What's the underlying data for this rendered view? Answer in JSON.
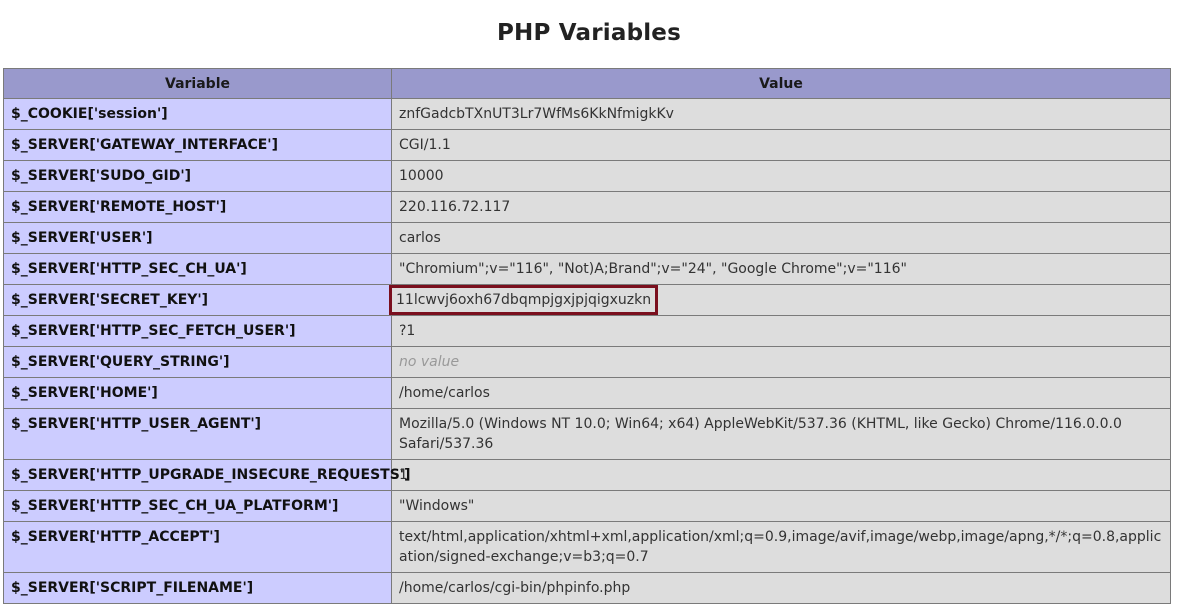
{
  "page_title": "PHP Variables",
  "columns": [
    "Variable",
    "Value"
  ],
  "rows": [
    {
      "name": "$_COOKIE['session']",
      "value": "znfGadcbTXnUT3Lr7WfMs6KkNfmigkKv"
    },
    {
      "name": "$_SERVER['GATEWAY_INTERFACE']",
      "value": "CGI/1.1"
    },
    {
      "name": "$_SERVER['SUDO_GID']",
      "value": "10000"
    },
    {
      "name": "$_SERVER['REMOTE_HOST']",
      "value": "220.116.72.117"
    },
    {
      "name": "$_SERVER['USER']",
      "value": "carlos"
    },
    {
      "name": "$_SERVER['HTTP_SEC_CH_UA']",
      "value": "\"Chromium\";v=\"116\", \"Not)A;Brand\";v=\"24\", \"Google Chrome\";v=\"116\""
    },
    {
      "name": "$_SERVER['SECRET_KEY']",
      "value": "11lcwvj6oxh67dbqmpjgxjpjqigxuzkn",
      "highlighted": true
    },
    {
      "name": "$_SERVER['HTTP_SEC_FETCH_USER']",
      "value": "?1"
    },
    {
      "name": "$_SERVER['QUERY_STRING']",
      "value": "no value",
      "empty": true
    },
    {
      "name": "$_SERVER['HOME']",
      "value": "/home/carlos"
    },
    {
      "name": "$_SERVER['HTTP_USER_AGENT']",
      "value": "Mozilla/5.0 (Windows NT 10.0; Win64; x64) AppleWebKit/537.36 (KHTML, like Gecko) Chrome/116.0.0.0 Safari/537.36",
      "tall": true
    },
    {
      "name": "$_SERVER['HTTP_UPGRADE_INSECURE_REQUESTS']",
      "value": "1"
    },
    {
      "name": "$_SERVER['HTTP_SEC_CH_UA_PLATFORM']",
      "value": "\"Windows\""
    },
    {
      "name": "$_SERVER['HTTP_ACCEPT']",
      "value": "text/html,application/xhtml+xml,application/xml;q=0.9,image/avif,image/webp,image/apng,*/*;q=0.8,application/signed-exchange;v=b3;q=0.7",
      "tall": true
    },
    {
      "name": "$_SERVER['SCRIPT_FILENAME']",
      "value": "/home/carlos/cgi-bin/phpinfo.php"
    }
  ],
  "colors": {
    "header_bg": "#9999cc",
    "name_cell_bg": "#ccccff",
    "value_cell_bg": "#dddddd",
    "highlight_border": "#7a0f1e"
  }
}
